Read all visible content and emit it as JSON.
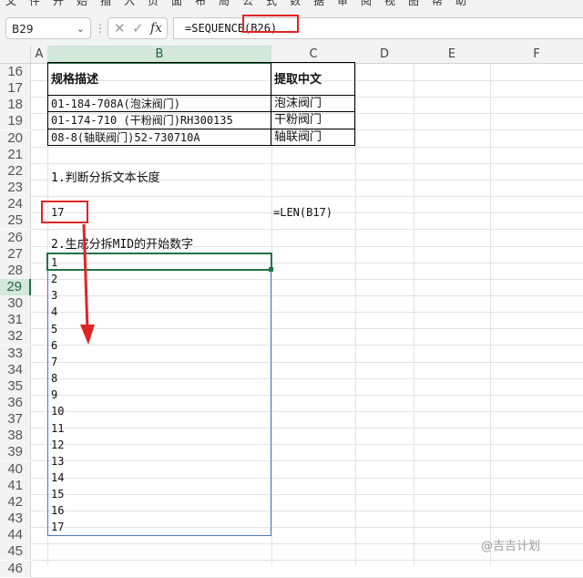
{
  "formula_bar": {
    "name_box": "B29",
    "formula_prefix": "=SEQUENCE(",
    "formula_arg": "B26)",
    "cancel_glyph": "✕",
    "enter_glyph": "✓",
    "fx_label": "fx"
  },
  "columns": [
    "A",
    "B",
    "C",
    "D",
    "E",
    "F"
  ],
  "selected_column": "B",
  "rows": [
    16,
    17,
    18,
    19,
    20,
    21,
    22,
    23,
    24,
    25,
    26,
    27,
    28,
    29,
    30,
    31,
    32,
    33,
    34,
    35,
    36,
    37,
    38,
    39,
    40,
    41,
    42,
    43,
    44,
    45,
    46
  ],
  "selected_row": 29,
  "table": {
    "header": [
      "规格描述",
      "提取中文"
    ],
    "rows": [
      [
        "01-184-708A(泡沫阀门)",
        "泡沫阀门"
      ],
      [
        "01-174-710  (干粉阀门)RH300135",
        "干粉阀门"
      ],
      [
        "08-8(轴联阀门)52-730710A",
        "轴联阀门"
      ]
    ]
  },
  "step1_label": "1.判断分拆文本长度",
  "b26_value": "17",
  "c26_formula": "=LEN(B17)",
  "step2_label": "2.生成分拆MID的开始数字",
  "sequence_values": [
    "1",
    "2",
    "3",
    "4",
    "5",
    "6",
    "7",
    "8",
    "9",
    "10",
    "11",
    "12",
    "13",
    "14",
    "15",
    "16",
    "17"
  ],
  "watermark": "@吉吉计划",
  "colors": {
    "accent_green": "#217346",
    "highlight_red": "#e02424",
    "spill_blue": "#4a78c2"
  }
}
